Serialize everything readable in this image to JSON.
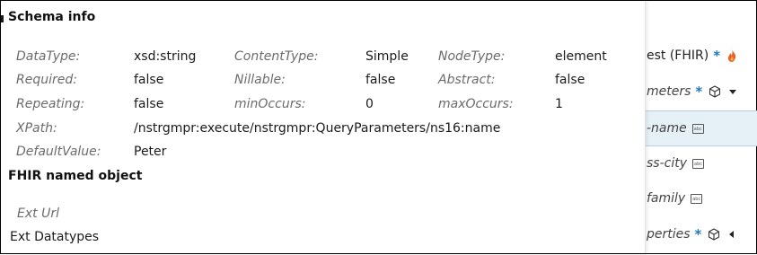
{
  "schema_info": {
    "title": "Schema info",
    "rows": [
      [
        {
          "label": "DataType:",
          "value": "xsd:string"
        },
        {
          "label": "ContentType:",
          "value": "Simple"
        },
        {
          "label": "NodeType:",
          "value": "element"
        }
      ],
      [
        {
          "label": "Required:",
          "value": "false"
        },
        {
          "label": "Nillable:",
          "value": "false"
        },
        {
          "label": "Abstract:",
          "value": "false"
        }
      ],
      [
        {
          "label": "Repeating:",
          "value": "false"
        },
        {
          "label": "minOccurs:",
          "value": "0"
        },
        {
          "label": "maxOccurs:",
          "value": "1"
        }
      ]
    ],
    "xpath_label": "XPath:",
    "xpath_value": "/nstrgmpr:execute/nstrgmpr:QueryParameters/ns16:name",
    "default_label": "DefaultValue:",
    "default_value": "Peter"
  },
  "fhir": {
    "title": "FHIR named object",
    "ext_url_label": "Ext Url",
    "ext_datatypes_label": "Ext Datatypes"
  },
  "tree": {
    "items": [
      {
        "label": "est (FHIR)",
        "star": "*",
        "icon": "fire-icon"
      },
      {
        "label": "meters",
        "star": "*",
        "icon": "cube-icon",
        "caret": "caret-down-icon"
      },
      {
        "label": "-name",
        "icon": "abc-icon",
        "selected": true
      },
      {
        "label": "ss-city",
        "icon": "abc-icon"
      },
      {
        "label": "family",
        "icon": "abc-icon"
      },
      {
        "label": "perties",
        "star": "*",
        "icon": "cube-icon",
        "caret": "caret-left-icon"
      }
    ],
    "abc_text": "abc"
  },
  "colors": {
    "accent": "#1e7bc2",
    "fire": "#e8622a",
    "selected_bg": "#e6f0f7"
  }
}
